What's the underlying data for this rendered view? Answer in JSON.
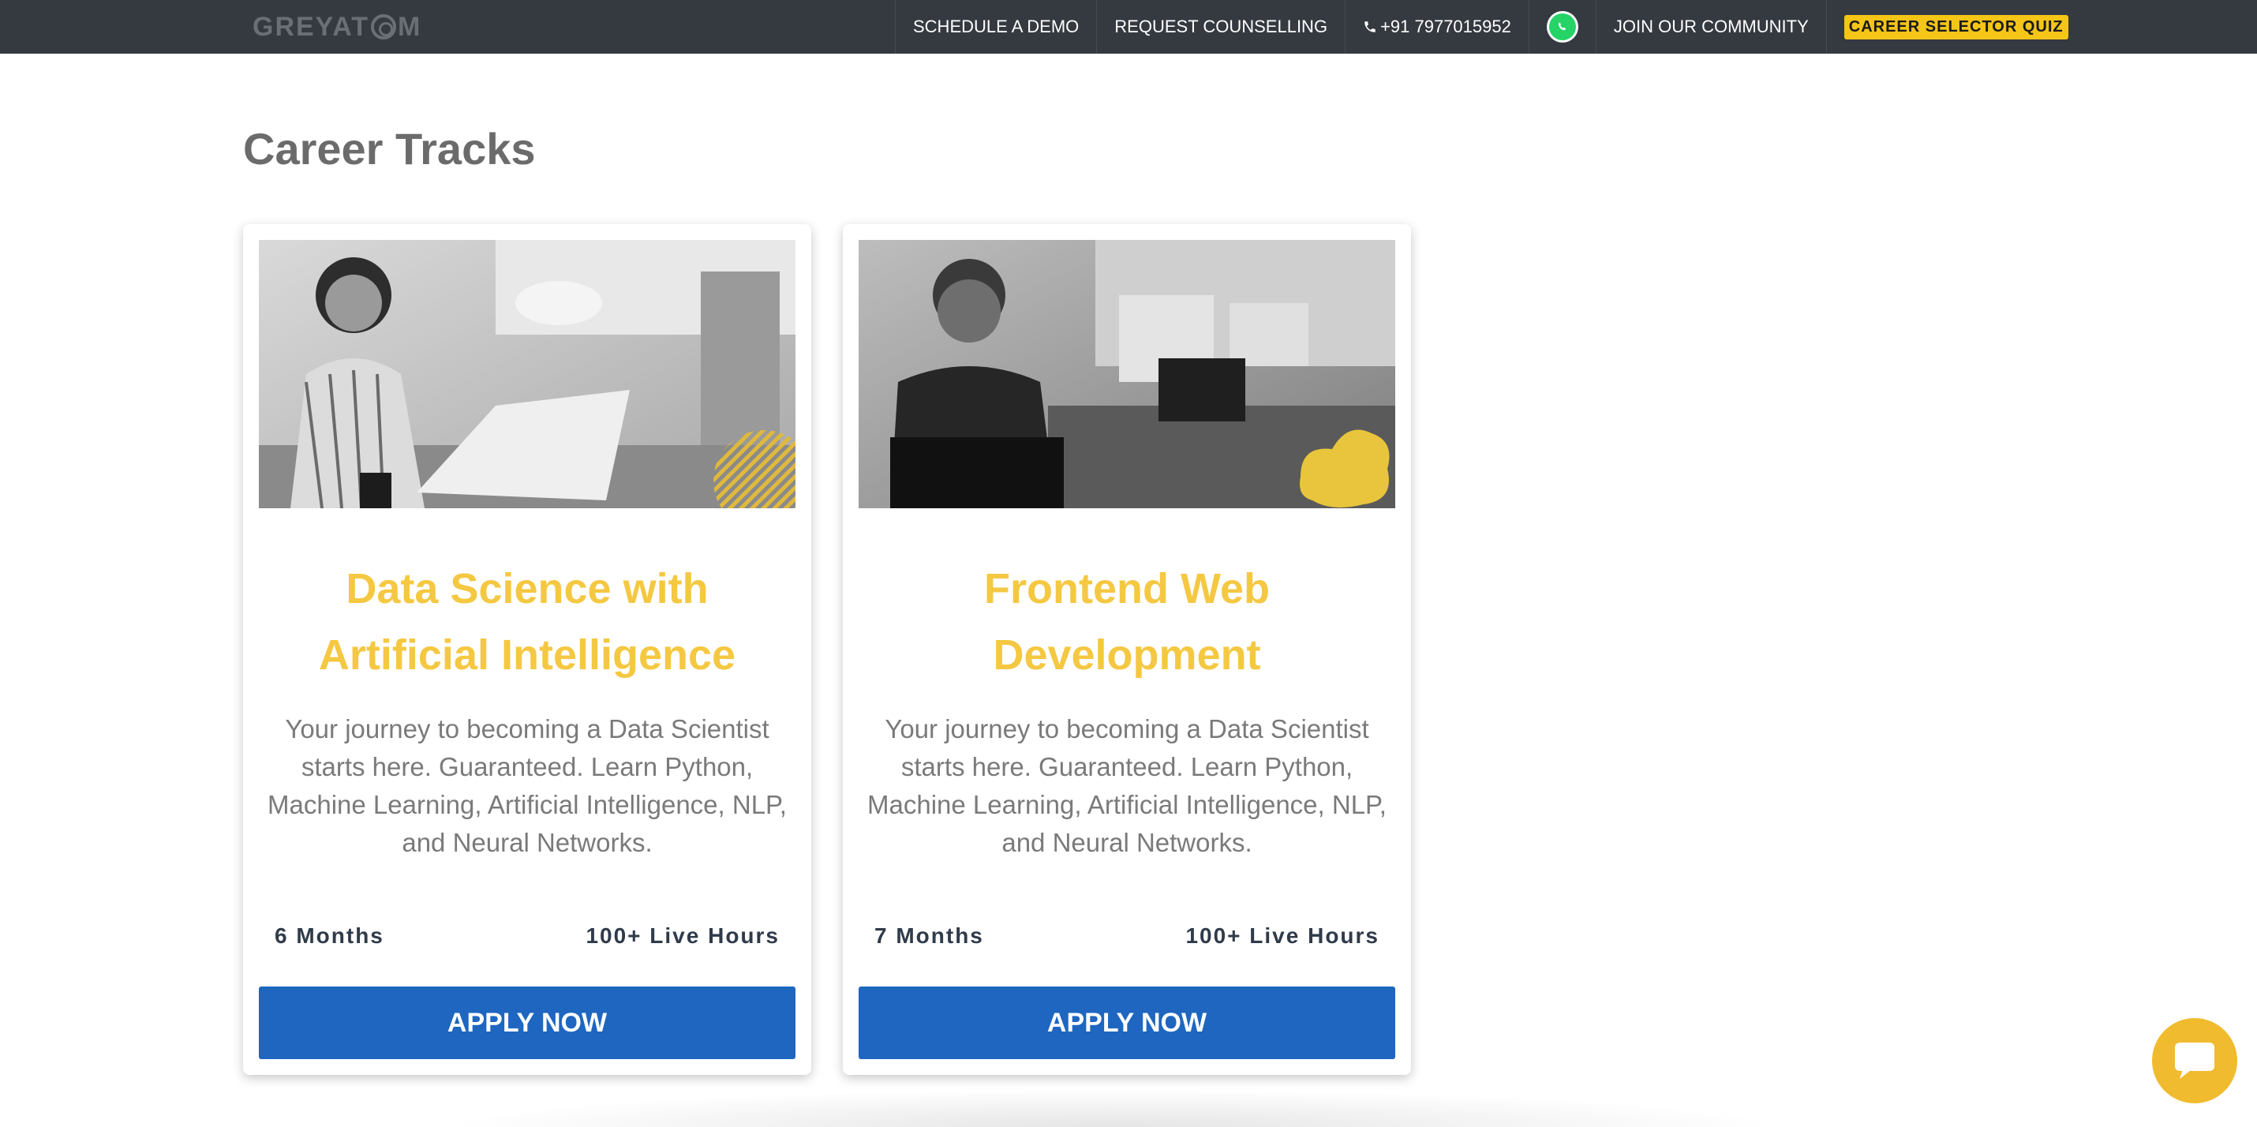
{
  "header": {
    "logo_text": "GREYATOM",
    "nav": {
      "schedule_demo": "SCHEDULE A DEMO",
      "request_counselling": "REQUEST COUNSELLING",
      "phone": "+91 7977015952",
      "whatsapp_icon": "whatsapp-icon",
      "join_community": "JOIN OUR COMMUNITY",
      "career_quiz": "CAREER SELECTOR QUIZ"
    }
  },
  "section": {
    "title": "Career Tracks"
  },
  "cards": [
    {
      "title": "Data Science with Artificial Intelligence",
      "description": "Your journey to becoming a Data Scientist starts here. Guaranteed. Learn Python, Machine Learning, Artificial Intelligence, NLP, and Neural Networks.",
      "duration": "6 Months",
      "hours": "100+ Live Hours",
      "apply_label": "APPLY NOW"
    },
    {
      "title": "Frontend Web Development",
      "description": "Your journey to becoming a Data Scientist starts here. Guaranteed. Learn Python, Machine Learning, Artificial Intelligence, NLP, and Neural Networks.",
      "duration": "7 Months",
      "hours": "100+ Live Hours",
      "apply_label": "APPLY NOW"
    }
  ],
  "colors": {
    "topbar": "#353a41",
    "accent_yellow": "#f5c842",
    "apply_blue": "#1e66c0",
    "chat_yellow": "#f0bb2e"
  },
  "chat_icon": "chat-bubble-icon"
}
